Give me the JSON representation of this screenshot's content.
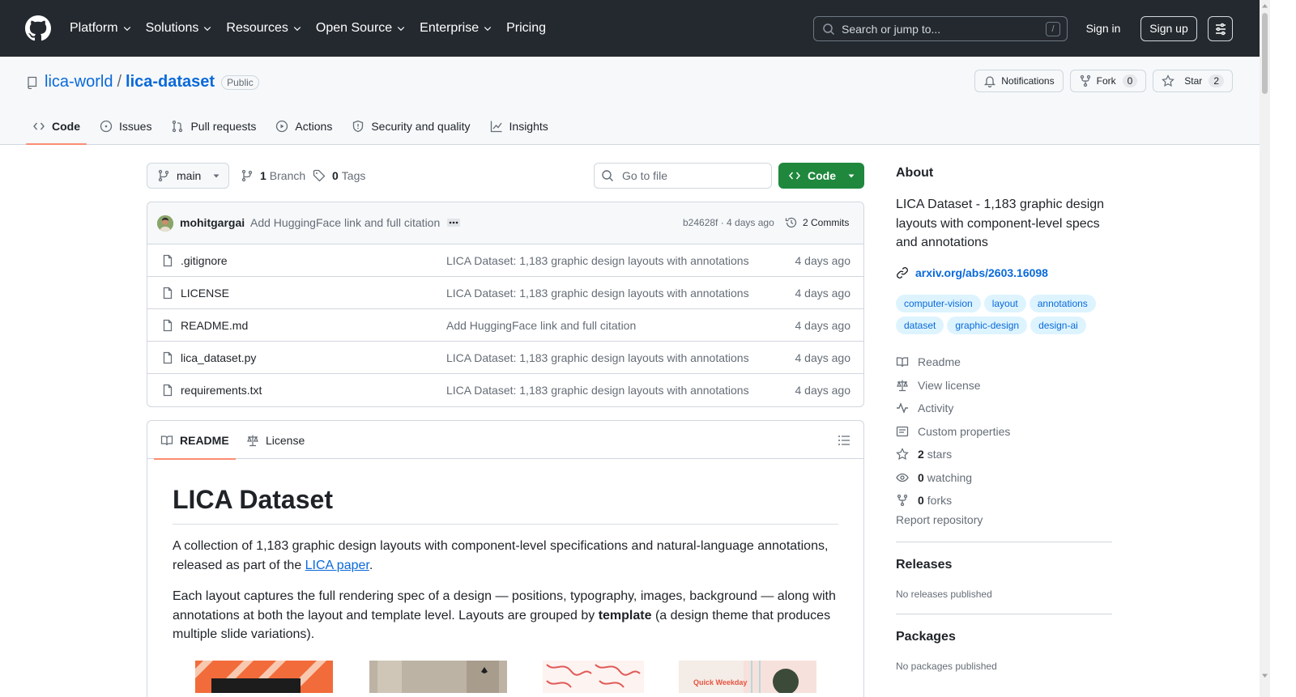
{
  "header": {
    "nav": [
      {
        "label": "Platform",
        "dropdown": true
      },
      {
        "label": "Solutions",
        "dropdown": true
      },
      {
        "label": "Resources",
        "dropdown": true
      },
      {
        "label": "Open Source",
        "dropdown": true
      },
      {
        "label": "Enterprise",
        "dropdown": true
      },
      {
        "label": "Pricing",
        "dropdown": false
      }
    ],
    "search_placeholder": "Search or jump to...",
    "search_shortcut": "/",
    "signin": "Sign in",
    "signup": "Sign up"
  },
  "repo": {
    "owner": "lica-world",
    "separator": "/",
    "name": "lica-dataset",
    "visibility": "Public",
    "notifications_label": "Notifications",
    "fork_label": "Fork",
    "fork_count": "0",
    "star_label": "Star",
    "star_count": "2",
    "tabs": [
      {
        "label": "Code",
        "icon": "code-icon",
        "active": true
      },
      {
        "label": "Issues",
        "icon": "issue-icon",
        "active": false
      },
      {
        "label": "Pull requests",
        "icon": "pull-request-icon",
        "active": false
      },
      {
        "label": "Actions",
        "icon": "play-icon",
        "active": false
      },
      {
        "label": "Security and quality",
        "icon": "shield-icon",
        "active": false
      },
      {
        "label": "Insights",
        "icon": "graph-icon",
        "active": false
      }
    ]
  },
  "file_nav": {
    "branch": "main",
    "branch_count": "1",
    "branch_label": "Branch",
    "tag_count": "0",
    "tag_label": "Tags",
    "goto_placeholder": "Go to file",
    "code_button": "Code"
  },
  "commit": {
    "author": "mohitgargai",
    "message": "Add HuggingFace link and full citation",
    "meta": "b24628f · 4 days ago",
    "count_label": "2 Commits"
  },
  "files": [
    {
      "name": ".gitignore",
      "commit": "LICA Dataset: 1,183 graphic design layouts with annotations",
      "age": "4 days ago"
    },
    {
      "name": "LICENSE",
      "commit": "LICA Dataset: 1,183 graphic design layouts with annotations",
      "age": "4 days ago"
    },
    {
      "name": "README.md",
      "commit": "Add HuggingFace link and full citation",
      "age": "4 days ago"
    },
    {
      "name": "lica_dataset.py",
      "commit": "LICA Dataset: 1,183 graphic design layouts with annotations",
      "age": "4 days ago"
    },
    {
      "name": "requirements.txt",
      "commit": "LICA Dataset: 1,183 graphic design layouts with annotations",
      "age": "4 days ago"
    }
  ],
  "readme": {
    "tab_readme": "README",
    "tab_license": "License",
    "title": "LICA Dataset",
    "p1_before": "A collection of 1,183 graphic design layouts with component-level specifications and natural-language annotations, released as part of the ",
    "p1_link": "LICA paper",
    "p1_after": ".",
    "p2_before": "Each layout captures the full rendering spec of a design — positions, typography, images, background — along with annotations at both the layout and template level. Layouts are grouped by ",
    "p2_bold": "template",
    "p2_after": " (a design theme that produces multiple slide variations).",
    "thumb_text": "Quick Weekday"
  },
  "about": {
    "heading": "About",
    "description": "LICA Dataset - 1,183 graphic design layouts with component-level specs and annotations",
    "link": "arxiv.org/abs/2603.16098",
    "topics": [
      "computer-vision",
      "layout",
      "annotations",
      "dataset",
      "graphic-design",
      "design-ai"
    ],
    "items": [
      {
        "icon": "book-icon",
        "count": "",
        "label": "Readme"
      },
      {
        "icon": "law-icon",
        "count": "",
        "label": "View license"
      },
      {
        "icon": "pulse-icon",
        "count": "",
        "label": "Activity"
      },
      {
        "icon": "note-icon",
        "count": "",
        "label": "Custom properties"
      },
      {
        "icon": "star-icon",
        "count": "2",
        "label": "stars"
      },
      {
        "icon": "eye-icon",
        "count": "0",
        "label": "watching"
      },
      {
        "icon": "fork-icon",
        "count": "0",
        "label": "forks"
      }
    ],
    "report": "Report repository",
    "releases_heading": "Releases",
    "releases_text": "No releases published",
    "packages_heading": "Packages",
    "packages_text": "No packages published"
  },
  "colors": {
    "header_bg": "#24292f",
    "link": "#0969da",
    "primary_button": "#1f883d",
    "active_tab_underline": "#fd8c73",
    "topic_bg": "#ddf4ff"
  }
}
